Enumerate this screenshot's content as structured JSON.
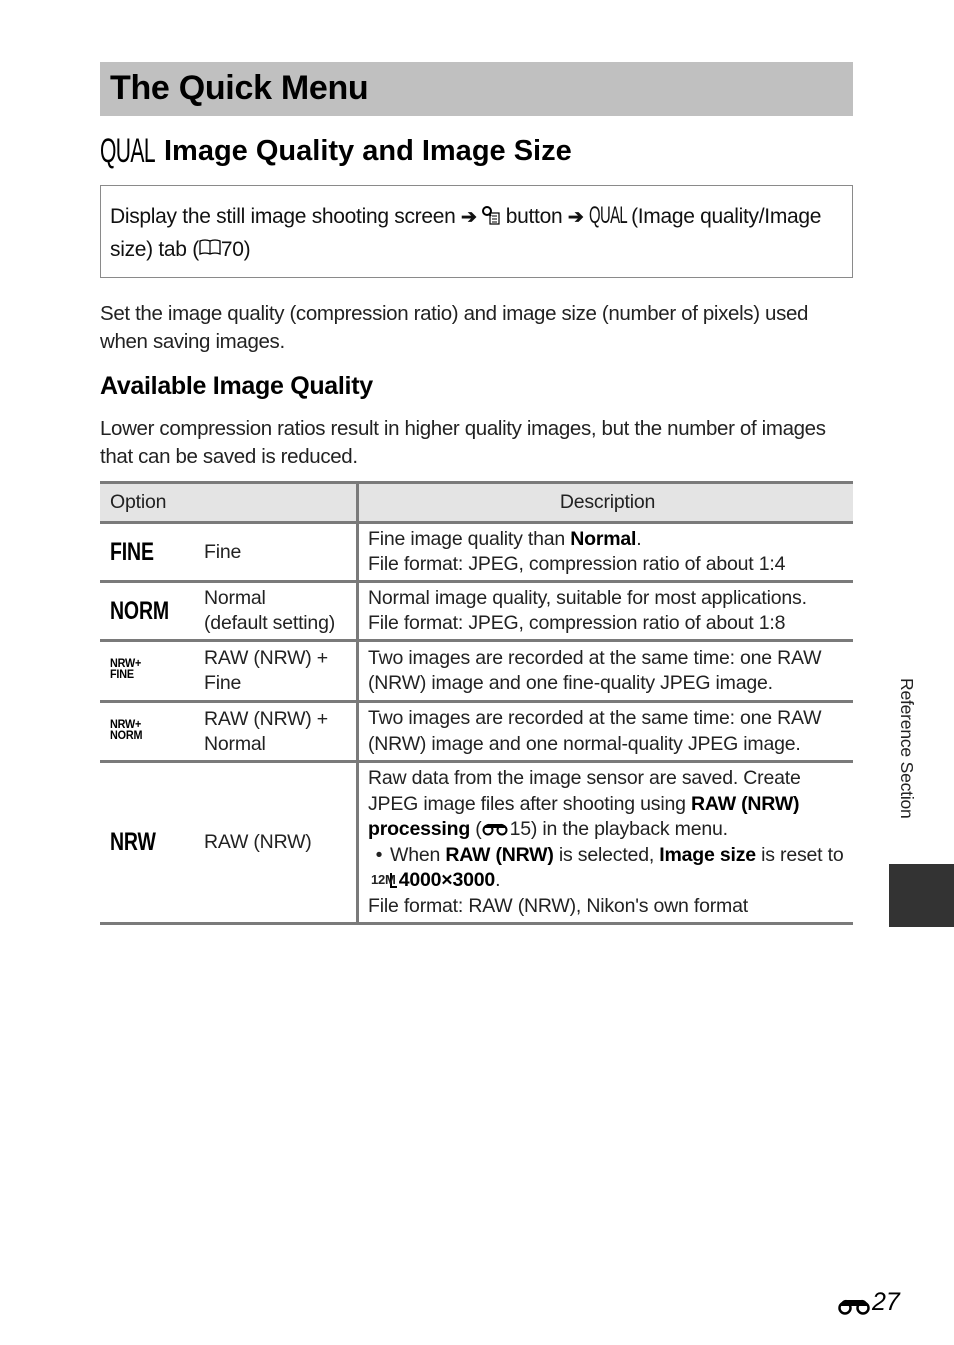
{
  "page_title": "The Quick Menu",
  "section": {
    "icon": "QUAL",
    "title": "Image Quality and Image Size"
  },
  "navigation": {
    "step1": "Display the still image shooting screen",
    "arrow": "➔",
    "step2_icon": "quick-menu-button-icon",
    "step2": "button",
    "step3_icon": "QUAL",
    "step3": "(Image quality/Image size) tab (",
    "book_icon": "🕮",
    "page_ref": "70)"
  },
  "intro": "Set the image quality (compression ratio) and image size (number of pixels) used when saving images.",
  "subheading": "Available Image Quality",
  "subheading_text": "Lower compression ratios result in higher quality images, but the number of images that can be saved is reduced.",
  "table": {
    "headers": {
      "option": "Option",
      "description": "Description"
    },
    "rows": [
      {
        "icon": "FINE",
        "option_lines": [
          "Fine"
        ],
        "desc": {
          "l1_a": "Fine image quality than ",
          "l1_b": "Normal",
          "l1_c": ".",
          "l2": "File format: JPEG, compression ratio of about 1:4"
        }
      },
      {
        "icon": "NORM",
        "option_lines": [
          "Normal",
          "(default setting)"
        ],
        "desc": {
          "l1": "Normal image quality, suitable for most applications.",
          "l2": "File format: JPEG, compression ratio of about 1:8"
        }
      },
      {
        "icon_top": "NRW+",
        "icon_bottom": "FINE",
        "option_lines": [
          "RAW (NRW) +",
          "Fine"
        ],
        "desc": {
          "l1": "Two images are recorded at the same time: one RAW",
          "l2": "(NRW) image and one fine-quality JPEG image."
        }
      },
      {
        "icon_top": "NRW+",
        "icon_bottom": "NORM",
        "option_lines": [
          "RAW (NRW) +",
          "Normal"
        ],
        "desc": {
          "l1": "Two images are recorded at the same time: one RAW",
          "l2": "(NRW) image and one normal-quality JPEG image."
        }
      },
      {
        "icon": "NRW",
        "option_lines": [
          "RAW (NRW)"
        ],
        "desc": {
          "p1": "Raw data from the image sensor are saved. Create JPEG image files after shooting using ",
          "p1_bold": "RAW (NRW) processing",
          "p1_ref_open": " (",
          "p1_ref": "15",
          "p1_end": ") in the playback menu.",
          "bullet": "•",
          "b_a": "When ",
          "b_bold1": "RAW (NRW)",
          "b_b": " is selected, ",
          "b_bold2": "Image size",
          "b_c": " is reset to ",
          "size_icon": "12M",
          "b_bold3": "4000×3000",
          "b_d": ".",
          "last": "File format: RAW (NRW), Nikon's own format"
        }
      }
    ]
  },
  "side_label": "Reference Section",
  "page_number": "27"
}
